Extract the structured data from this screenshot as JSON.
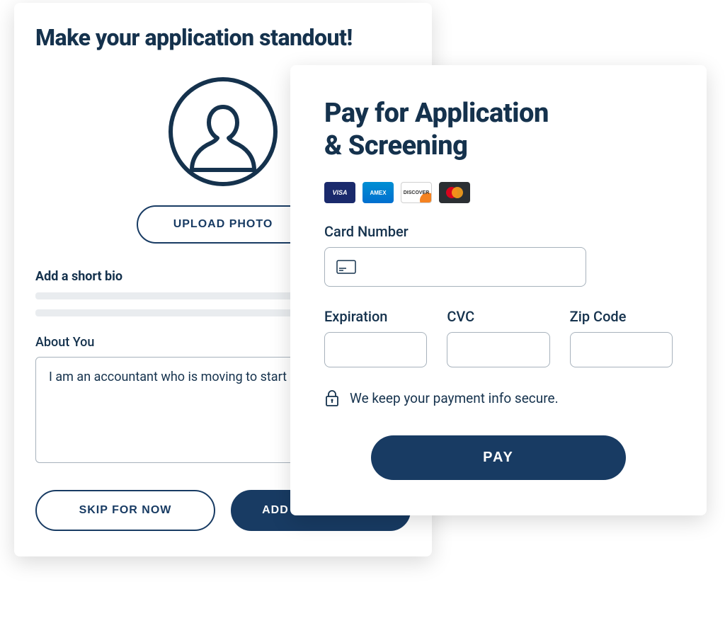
{
  "application": {
    "title": "Make your application standout!",
    "uploadLabel": "UPLOAD PHOTO",
    "bioSectionLabel": "Add a short bio",
    "aboutLabel": "About You",
    "aboutValue": "I am an accountant who is moving to start my new job.",
    "skipLabel": "SKIP FOR NOW",
    "addLabel": "ADD INFORMATION"
  },
  "payment": {
    "titleLine1": "Pay for Application",
    "titleLine2": "& Screening",
    "cardNumberLabel": "Card Number",
    "expirationLabel": "Expiration",
    "cvcLabel": "CVC",
    "zipLabel": "Zip Code",
    "secureText": "We keep your payment info secure.",
    "payLabel": "PAY",
    "icons": {
      "visa": "VISA",
      "amex": "AMEX",
      "discover": "DISCOVER"
    }
  }
}
